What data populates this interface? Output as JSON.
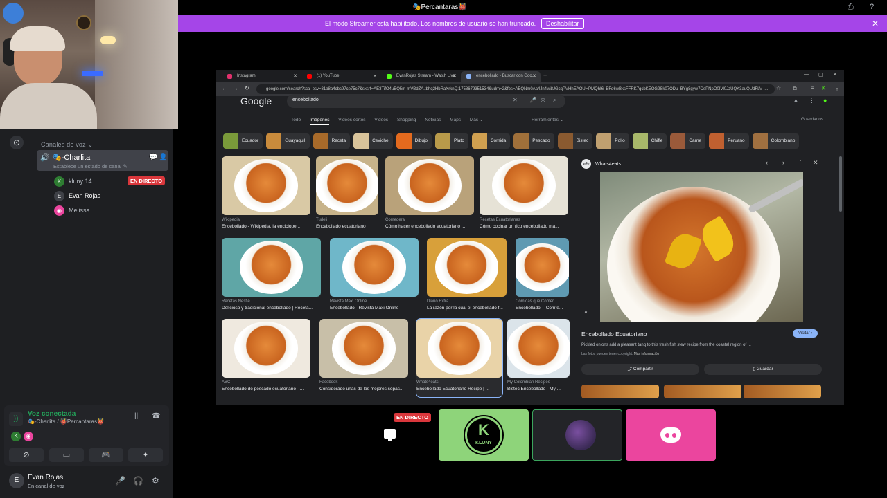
{
  "topbar": {
    "title": "🎭Percantaras👹"
  },
  "notice": {
    "message": "El modo Streamer está habilitado. Los nombres de usuario se han truncado.",
    "button": "Deshabilitar"
  },
  "sidebar": {
    "section": "Canales de voz ⌄",
    "channel": {
      "name": "🎭-Charlita",
      "status": "Establece un estado de canal ✎"
    },
    "users": [
      {
        "name": "kluny 14",
        "badge": "EN DIRECTO"
      },
      {
        "name": "Evan Rojas"
      },
      {
        "name": "Melissa"
      }
    ]
  },
  "voice": {
    "title": "Voz conectada",
    "subtitle": "🎭-Charlita / 👹Percantaras👹"
  },
  "userbar": {
    "name": "Evan Rojas",
    "status": "En canal de voz"
  },
  "browser": {
    "tabs": [
      {
        "label": "Instagram",
        "color": "#e1306c"
      },
      {
        "label": "(1) YouTube",
        "color": "#ff0000"
      },
      {
        "label": "EvanRojas Stream - Watch Live",
        "color": "#53fc18"
      },
      {
        "label": "encebollado - Buscar con Goo...",
        "color": "#8ab4f8"
      }
    ],
    "url": "google.com/search?sca_esv=81a8a4cbc97ce75c7&sxsrf=AE3TifO4uBQ5m-mVBdZA.tbhq2HbRaXrknQ:1758679351534&udm=2&fbs=AEQNm0Aa4Jn4wi8JGcqPVHhEAOUHPMQhI6_BFq6wBksFFRK7qcbKEOG9Sk07ODu_BYg8gyw7OsPNpO0IVl0JzUQK3auQUdFLV_...",
    "search": "encebollado",
    "logo": "Google",
    "gtabs": [
      "Todo",
      "Imágenes",
      "Videos cortos",
      "Videos",
      "Shopping",
      "Noticias",
      "Maps",
      "Más ⌄"
    ],
    "tools": "Herramientas ⌄",
    "saved": "Guardados",
    "chips": [
      "Ecuador",
      "Guayaquil",
      "Receta",
      "Ceviche",
      "Dibujo",
      "Plato",
      "Comida",
      "Pescado",
      "Bistec",
      "Pollo",
      "Chifle",
      "Carne",
      "Peruano",
      "Colombiano"
    ],
    "results": [
      {
        "src": "Wikipedia",
        "title": "Encebollado - Wikipedia, la enciclope..."
      },
      {
        "src": "Tudeli",
        "title": "Encebollado ecuatoriano"
      },
      {
        "src": "Comedera",
        "title": "Cómo hacer encebollado ecuatoriano ..."
      },
      {
        "src": "Recetas Ecuatorianas",
        "title": "Cómo cocinar un rico encebollado ma..."
      },
      {
        "src": "Recetas Nestlé",
        "title": "Delicioso y tradicional encebollado | Receta..."
      },
      {
        "src": "Revista Maxi Online",
        "title": "Encebollado - Revista Maxi Online"
      },
      {
        "src": "Diario Extra",
        "title": "La razón por la cual el encebollado f..."
      },
      {
        "src": "Comidas que Comer",
        "title": "Encebollado -- Comfe..."
      },
      {
        "src": "ABC",
        "title": "Encebollado de pescado ecuatoriano - ..."
      },
      {
        "src": "Facebook",
        "title": "Considerado unas de las mejores sopas..."
      },
      {
        "src": "Whats4eats",
        "title": "Encebollado Ecuatoriano Recipe | ..."
      },
      {
        "src": "My Colombian Recipes",
        "title": "Bistec Encebollado - My ..."
      }
    ],
    "panel": {
      "source": "Whats4eats",
      "title": "Encebollado Ecuatoriano",
      "visit": "Visitar ›",
      "description": "Pickled onions add a pleasant tang to this fresh fish stew recipe from the coastal region of ...",
      "copyright": "Las fotos pueden tener copyright.",
      "more": "Más información",
      "share": "Compartir",
      "save": "Guardar"
    }
  },
  "tiles": {
    "live": "EN DIRECTO",
    "kluny": "KLUNY"
  }
}
